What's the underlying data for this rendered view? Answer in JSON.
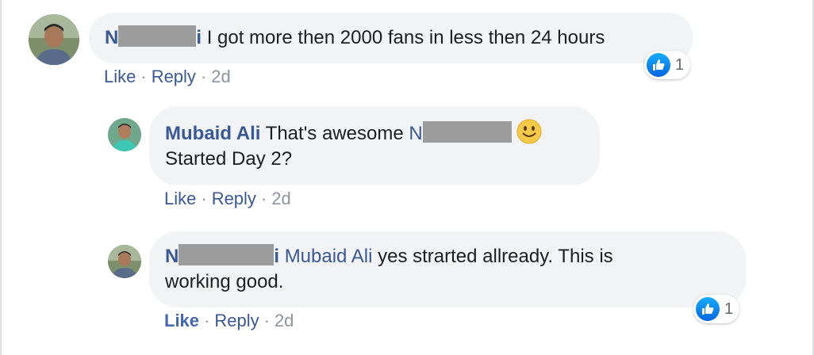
{
  "comments": [
    {
      "author_prefix": "N",
      "author_suffix": "i",
      "text": "I got more then 2000 fans in less then 24 hours",
      "actions": {
        "like": "Like",
        "reply": "Reply",
        "time": "2d"
      },
      "reaction_count": "1"
    },
    {
      "author": "Mubaid Ali",
      "text_before_mention": "That's awesome",
      "mention_prefix": "N",
      "text_line2": "Started Day 2?",
      "actions": {
        "like": "Like",
        "reply": "Reply",
        "time": "2d"
      }
    },
    {
      "author_prefix": "N",
      "author_suffix": "i",
      "mention": "Mubaid Ali",
      "text_line1": "yes strarted allready. This is",
      "text_line2": "working good.",
      "actions": {
        "like": "Like",
        "reply": "Reply",
        "time": "2d"
      },
      "reaction_count": "1"
    }
  ],
  "colors": {
    "name": "#385898",
    "bubble": "#f2f3f5",
    "like_blue": "#1877f2",
    "meta": "#8d949e"
  },
  "icons": [
    "like-icon",
    "smiley-emoji-icon"
  ]
}
